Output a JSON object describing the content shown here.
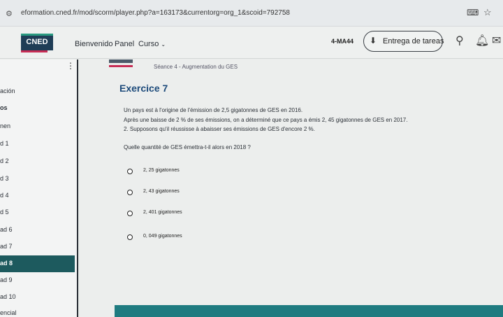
{
  "browser": {
    "url": "eformation.cned.fr/mod/scorm/player.php?a=163173&currentorg=org_1&scoid=792758",
    "site_info_icon": "tune-icon",
    "translate_icon": "translate-icon",
    "bookmark_icon": "star-icon"
  },
  "navbar": {
    "brand": "CNED",
    "items": [
      "Bienvenido",
      "Panel",
      "Curso"
    ],
    "course_code": "4-MA44",
    "tasks_label": "Entrega de tareas",
    "colors": {
      "brand_bg": "#1f3d56",
      "brand_accent": "#c62d55",
      "teal": "#2a9a80"
    }
  },
  "sidebar": {
    "items": [
      "ación",
      "os",
      "nen",
      "d 1",
      "d 2",
      "d 3",
      "d 4",
      "d 5",
      "ad 6",
      "ad 7",
      "ad 8",
      "ad 9",
      "ad 10",
      "encial"
    ],
    "active_index": 10,
    "active_color": "#1d5a5e"
  },
  "content": {
    "mini_logo": "CNED",
    "section_title": "Séance 4 - Augmentation du GES",
    "exercise_title": "Exercice 7",
    "paragraphs": [
      "Un pays est à l'origine de l'émission de 2,5 gigatonnes de GES en 2016.",
      "Après une baisse de 2 % de ses émissions, on a déterminé que ce pays a émis 2, 45 gigatonnes de GES en 2017.",
      "2. Supposons qu'il réussisse à abaisser ses émissions de GES d'encore 2 %.",
      "Quelle quantité de GES émettra-t-il alors en 2018 ?"
    ],
    "options": [
      "2, 25 gigatonnes",
      "2, 43 gigatonnes",
      "2, 401 gigatonnes",
      "0, 049 gigatonnes"
    ],
    "title_color": "#1c4a7a",
    "bottom_bar_color": "#1f7b80"
  }
}
